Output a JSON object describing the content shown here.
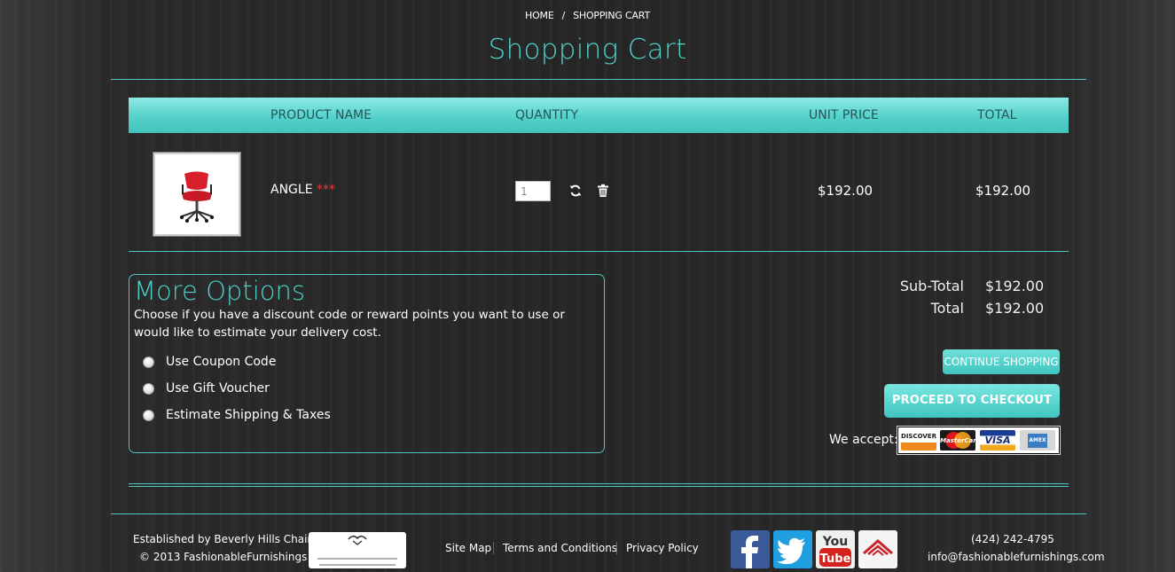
{
  "breadcrumb": {
    "home": "HOME",
    "separator": "/",
    "current": "SHOPPING CART"
  },
  "page_title": "Shopping Cart",
  "table": {
    "headers": [
      "PRODUCT NAME",
      "QUANTITY",
      "UNIT PRICE",
      "TOTAL"
    ],
    "rows": [
      {
        "name": "ANGLE",
        "marker": "***",
        "quantity": "1",
        "unit_price": "$192.00",
        "total": "$192.00"
      }
    ]
  },
  "options": {
    "title": "More Options",
    "description": "Choose if you have a discount code or reward points you want to use or would like to estimate your delivery cost.",
    "choices": [
      "Use Coupon Code",
      "Use Gift Voucher",
      "Estimate Shipping & Taxes"
    ]
  },
  "totals": {
    "subtotal_label": "Sub-Total",
    "subtotal": "$192.00",
    "total_label": "Total",
    "total": "$192.00"
  },
  "buttons": {
    "continue": "CONTINUE SHOPPING",
    "checkout": "PROCEED TO CHECKOUT"
  },
  "payments": {
    "label": "We accept:",
    "cards": [
      "DISCOVER",
      "MasterCard",
      "VISA",
      "AMEX"
    ]
  },
  "footer": {
    "established": "Established by Beverly Hills Chairs",
    "copyright": "© 2013 FashionableFurnishings",
    "partner_logo": "Beverly Hills CHAIRS",
    "links": [
      "Site Map",
      "Terms and Conditions",
      "Privacy Policy"
    ],
    "social": [
      "facebook-icon",
      "twitter-icon",
      "youtube-icon",
      "houzz-icon"
    ],
    "phone": "(424) 242-4795",
    "email": "info@fashionablefurnishings.com"
  },
  "colors": {
    "accent": "#4fd0c8",
    "header_bar": "#55d1ca",
    "marker": "#e23b3b"
  }
}
